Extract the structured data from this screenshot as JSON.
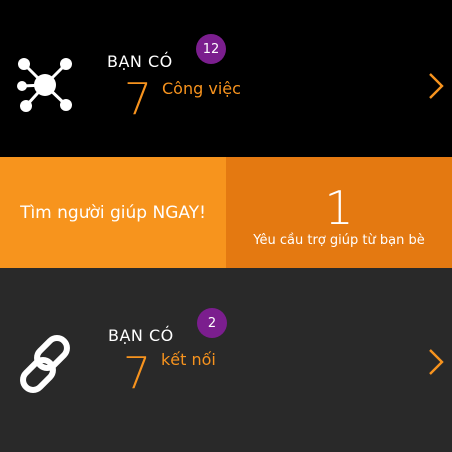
{
  "jobs": {
    "icon": "network-nodes-icon",
    "prefix": "BẠN CÓ",
    "count": "7",
    "unit": "Công việc",
    "badge": "12",
    "chevron_icon": "chevron-right-icon"
  },
  "help": {
    "cta": "Tìm người giúp NGAY!",
    "count": "1",
    "caption": "Yêu cầu trợ giúp từ bạn bè"
  },
  "connections": {
    "icon": "chain-link-icon",
    "prefix": "BẠN CÓ",
    "count": "7",
    "unit": "kết nối",
    "badge": "2",
    "chevron_icon": "chevron-right-icon"
  },
  "colors": {
    "accent_orange": "#f7931e",
    "help_left_bg": "#f7941d",
    "help_right_bg": "#e47911",
    "badge_purple": "#7b1e8e",
    "top_bg": "#000000",
    "bottom_bg": "#292929"
  }
}
